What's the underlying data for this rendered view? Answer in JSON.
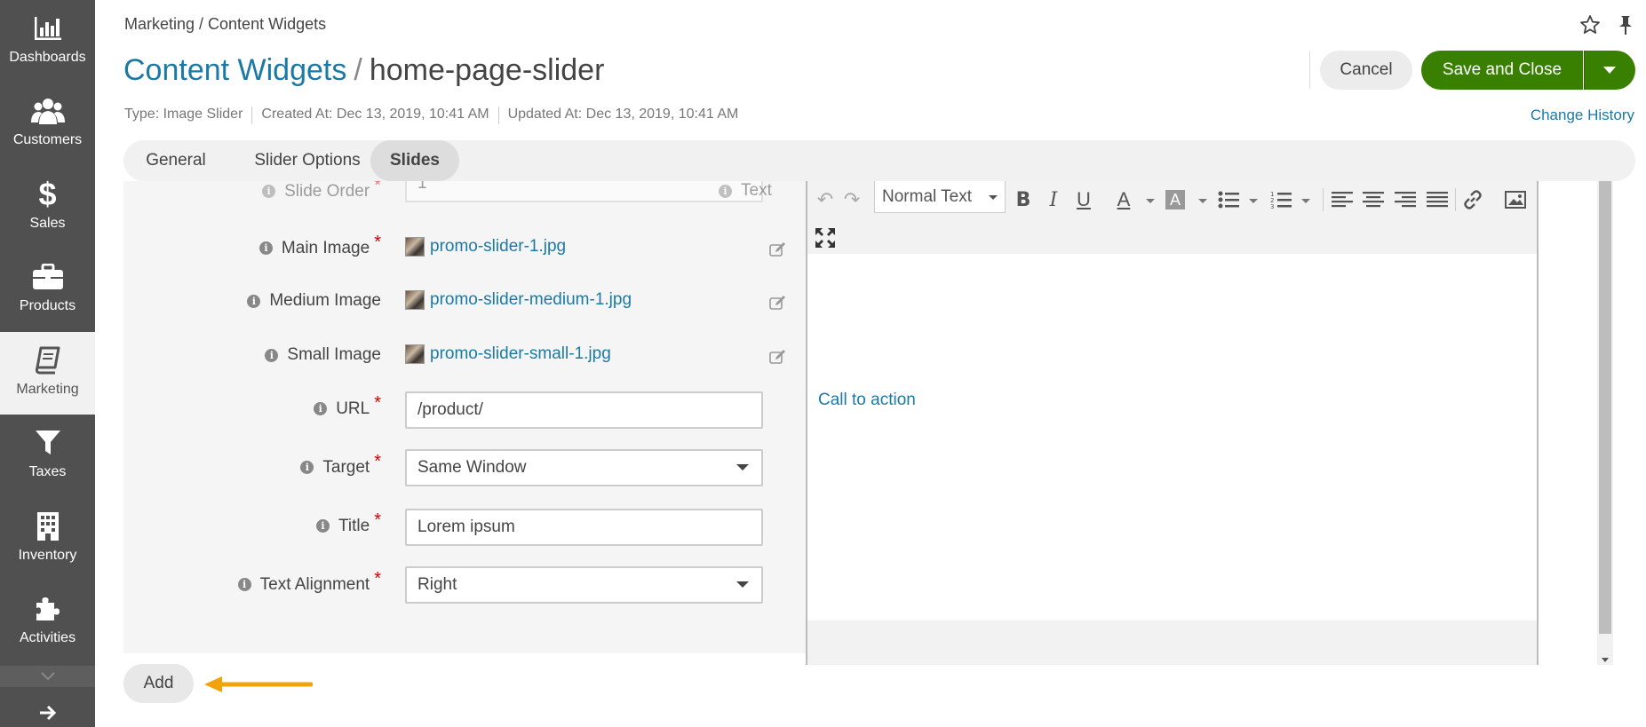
{
  "sidebar": {
    "items": [
      {
        "label": "Dashboards",
        "icon": "bar-chart-icon"
      },
      {
        "label": "Customers",
        "icon": "users-icon"
      },
      {
        "label": "Sales",
        "icon": "dollar-icon"
      },
      {
        "label": "Products",
        "icon": "briefcase-icon"
      },
      {
        "label": "Marketing",
        "icon": "book-icon"
      },
      {
        "label": "Taxes",
        "icon": "filter-icon"
      },
      {
        "label": "Inventory",
        "icon": "building-icon"
      },
      {
        "label": "Activities",
        "icon": "puzzle-icon"
      }
    ],
    "active": "Marketing"
  },
  "header": {
    "breadcrumb": "Marketing / Content Widgets",
    "title_link": "Content Widgets",
    "title_sep": "/",
    "title_name": "home-page-slider",
    "meta_type": "Type: Image Slider",
    "meta_created": "Created At: Dec 13, 2019, 10:41 AM",
    "meta_updated": "Updated At: Dec 13, 2019, 10:41 AM",
    "change_history": "Change History",
    "cancel_label": "Cancel",
    "save_label": "Save and Close"
  },
  "tabs": [
    {
      "label": "General"
    },
    {
      "label": "Slider Options"
    },
    {
      "label": "Slides"
    }
  ],
  "form": {
    "slide_order_label": "Slide Order",
    "slide_order_value": "1",
    "text_label": "Text",
    "main_image_label": "Main Image",
    "main_image_file": "promo-slider-1.jpg",
    "medium_image_label": "Medium Image",
    "medium_image_file": "promo-slider-medium-1.jpg",
    "small_image_label": "Small Image",
    "small_image_file": "promo-slider-small-1.jpg",
    "url_label": "URL",
    "url_value": "/product/",
    "target_label": "Target",
    "target_value": "Same Window",
    "title_label": "Title",
    "title_value": "Lorem ipsum",
    "alignment_label": "Text Alignment",
    "alignment_value": "Right"
  },
  "editor": {
    "format_value": "Normal Text",
    "content_link": "Call to action"
  },
  "actions": {
    "add_label": "Add"
  },
  "colors": {
    "accent": "#1b7aa5",
    "primary_button": "#3a8000",
    "sidebar": "#505050",
    "annotation_arrow": "#f0a30a"
  }
}
